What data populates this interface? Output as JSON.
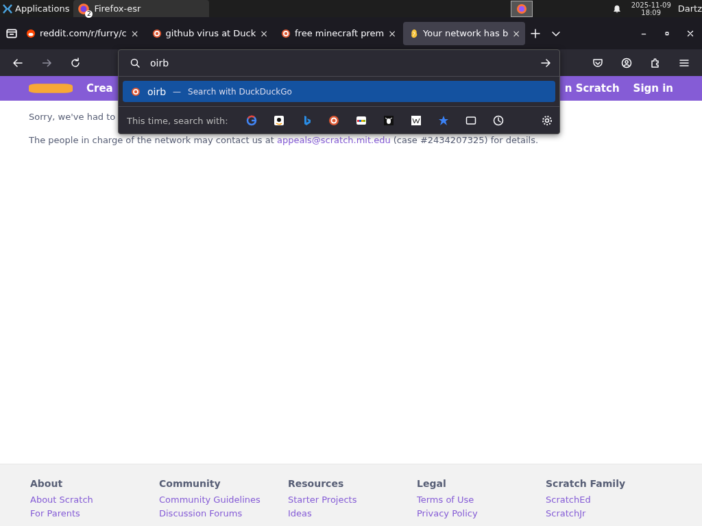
{
  "taskbar": {
    "menu": "Applications",
    "window": {
      "title": "Firefox-esr",
      "count": "2"
    },
    "date": "2025-11-09",
    "time": "18:09",
    "user": "Dartz"
  },
  "tabs": [
    {
      "title": "reddit.com/r/furry/c",
      "kind": "reddit",
      "selected": false,
      "close": "×"
    },
    {
      "title": "github virus at Duck",
      "kind": "duck",
      "selected": false,
      "close": "×"
    },
    {
      "title": "free minecraft prem",
      "kind": "duck",
      "selected": false,
      "close": "×"
    },
    {
      "title": "Your network has b",
      "kind": "scratch",
      "selected": true,
      "close": "×"
    }
  ],
  "urlbar": {
    "value": "oirb",
    "suggestion": {
      "query": "oirb",
      "separator": "—",
      "action": "Search with DuckDuckGo",
      "selected": true
    },
    "engines_label": "This time, search with:"
  },
  "site_nav": {
    "items": [
      "Crea",
      "n Scratch",
      "Sign in"
    ]
  },
  "content": {
    "paragraphs": [
      "Sorry, we've had to",
      "The people in charge of the network may contact us at **appeals@scratch.mit.edu** (case #2434207325) for details."
    ]
  },
  "footer": {
    "columns": [
      {
        "heading": "About",
        "links": [
          "About Scratch",
          "For Parents"
        ]
      },
      {
        "heading": "Community",
        "links": [
          "Community Guidelines",
          "Discussion Forums"
        ]
      },
      {
        "heading": "Resources",
        "links": [
          "Starter Projects",
          "Ideas"
        ]
      },
      {
        "heading": "Legal",
        "links": [
          "Terms of Use",
          "Privacy Policy"
        ]
      },
      {
        "heading": "Scratch Family",
        "links": [
          "ScratchEd",
          "ScratchJr"
        ]
      }
    ]
  }
}
